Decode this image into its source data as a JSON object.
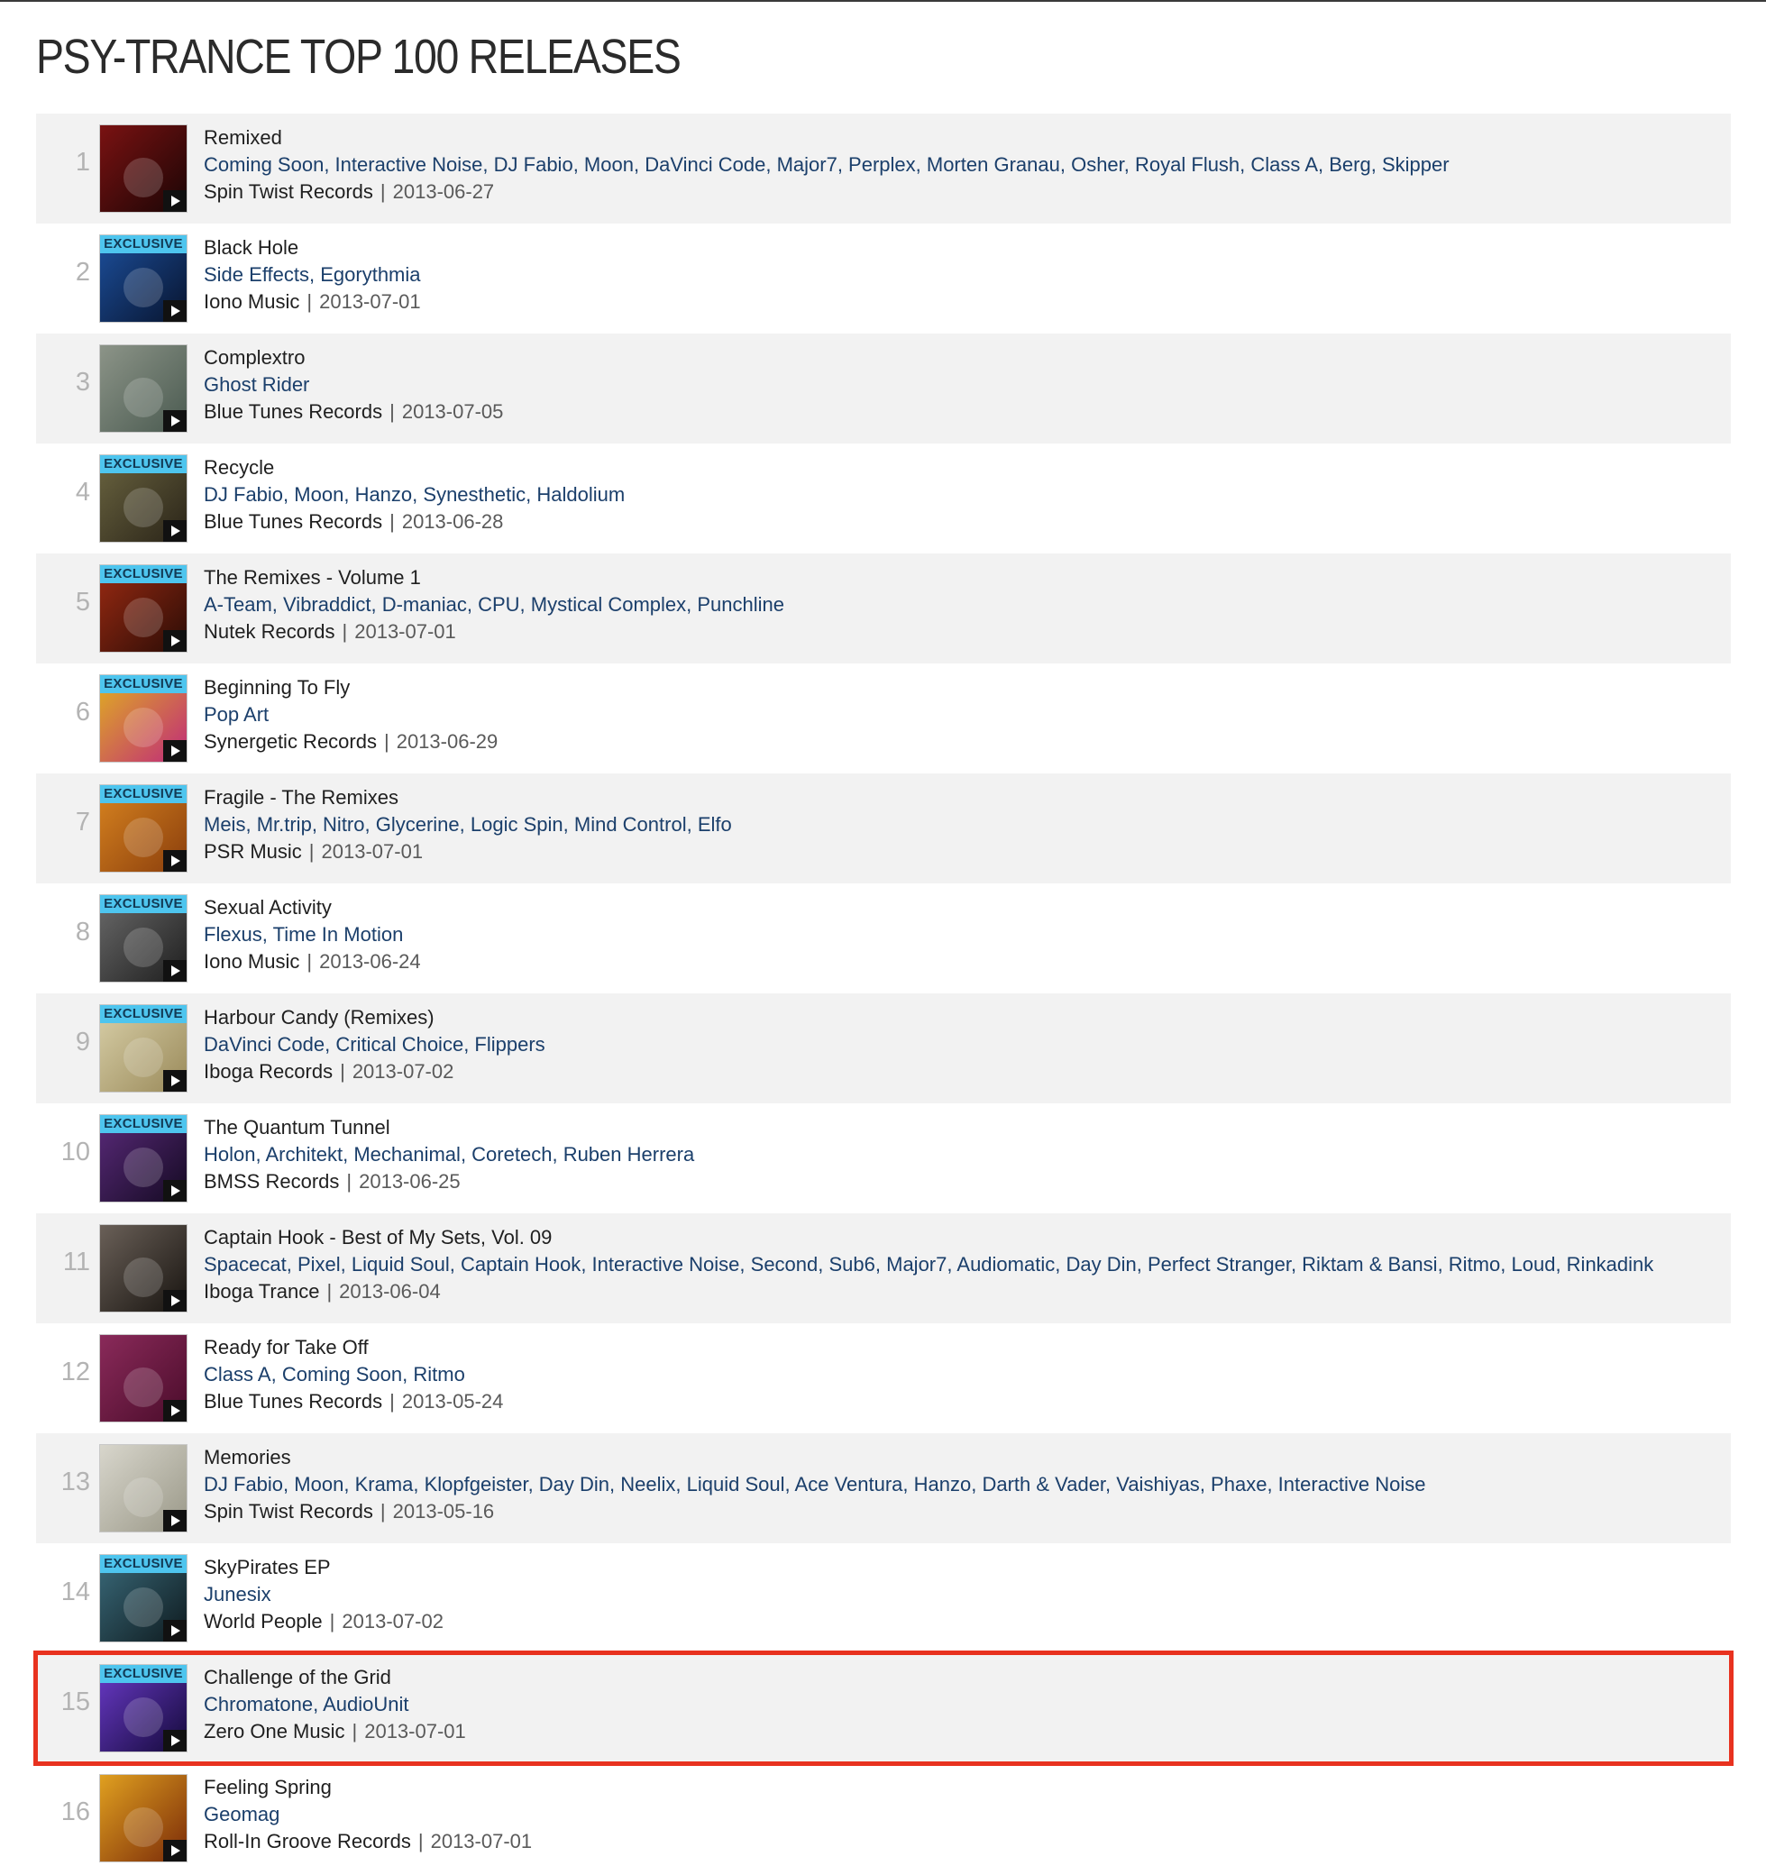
{
  "page": {
    "title": "PSY-TRANCE TOP 100 RELEASES"
  },
  "exclusive_label": "EXCLUSIVE",
  "releases": [
    {
      "rank": "1",
      "title": "Remixed",
      "artists": [
        "Coming Soon",
        "Interactive Noise",
        "DJ Fabio",
        "Moon",
        "DaVinci Code",
        "Major7",
        "Perplex",
        "Morten Granau",
        "Osher",
        "Royal Flush",
        "Class A",
        "Berg",
        "Skipper"
      ],
      "label": "Spin Twist Records",
      "date": "2013-06-27",
      "exclusive": false,
      "cover_color": "#7a1212",
      "cover_color2": "#1a0505"
    },
    {
      "rank": "2",
      "title": "Black Hole",
      "artists": [
        "Side Effects",
        "Egorythmia"
      ],
      "label": "Iono Music",
      "date": "2013-07-01",
      "exclusive": true,
      "cover_color": "#1c4f9c",
      "cover_color2": "#08142e"
    },
    {
      "rank": "3",
      "title": "Complextro",
      "artists": [
        "Ghost Rider"
      ],
      "label": "Blue Tunes Records",
      "date": "2013-07-05",
      "exclusive": false,
      "cover_color": "#8c9488",
      "cover_color2": "#4a5a50"
    },
    {
      "rank": "4",
      "title": "Recycle",
      "artists": [
        "DJ Fabio",
        "Moon",
        "Hanzo",
        "Synesthetic",
        "Haldolium"
      ],
      "label": "Blue Tunes Records",
      "date": "2013-06-28",
      "exclusive": true,
      "cover_color": "#6a6440",
      "cover_color2": "#2a2418"
    },
    {
      "rank": "5",
      "title": "The Remixes - Volume 1",
      "artists": [
        "A-Team",
        "Vibraddict",
        "D-maniac",
        "CPU",
        "Mystical Complex",
        "Punchline"
      ],
      "label": "Nutek Records",
      "date": "2013-07-01",
      "exclusive": true,
      "cover_color": "#9a2a12",
      "cover_color2": "#2a0c06"
    },
    {
      "rank": "6",
      "title": "Beginning To Fly",
      "artists": [
        "Pop Art"
      ],
      "label": "Synergetic Records",
      "date": "2013-06-29",
      "exclusive": true,
      "cover_color": "#e0b020",
      "cover_color2": "#c02a7a"
    },
    {
      "rank": "7",
      "title": "Fragile - The Remixes",
      "artists": [
        "Meis",
        "Mr.trip",
        "Nitro",
        "Glycerine",
        "Logic Spin",
        "Mind Control",
        "Elfo"
      ],
      "label": "PSR Music",
      "date": "2013-07-01",
      "exclusive": true,
      "cover_color": "#d88420",
      "cover_color2": "#8a3e0c"
    },
    {
      "rank": "8",
      "title": "Sexual Activity",
      "artists": [
        "Flexus",
        "Time In Motion"
      ],
      "label": "Iono Music",
      "date": "2013-06-24",
      "exclusive": true,
      "cover_color": "#6a6a6a",
      "cover_color2": "#1e1e1e"
    },
    {
      "rank": "9",
      "title": "Harbour Candy (Remixes)",
      "artists": [
        "DaVinci Code",
        "Critical Choice",
        "Flippers"
      ],
      "label": "Iboga Records",
      "date": "2013-07-02",
      "exclusive": true,
      "cover_color": "#d8cfa8",
      "cover_color2": "#9a8a5a"
    },
    {
      "rank": "10",
      "title": "The Quantum Tunnel",
      "artists": [
        "Holon",
        "Architekt",
        "Mechanimal",
        "Coretech",
        "Ruben Herrera"
      ],
      "label": "BMSS Records",
      "date": "2013-06-25",
      "exclusive": true,
      "cover_color": "#5a2a7a",
      "cover_color2": "#140a22"
    },
    {
      "rank": "11",
      "title": "Captain Hook - Best of My Sets, Vol. 09",
      "artists": [
        "Spacecat",
        "Pixel",
        "Liquid Soul",
        "Captain Hook",
        "Interactive Noise",
        "Second",
        "Sub6",
        "Major7",
        "Audiomatic",
        "Day Din",
        "Perfect Stranger",
        "Riktam & Bansi",
        "Ritmo",
        "Loud",
        "Rinkadink"
      ],
      "label": "Iboga Trance",
      "date": "2013-06-04",
      "exclusive": false,
      "cover_color": "#6a6058",
      "cover_color2": "#181410"
    },
    {
      "rank": "12",
      "title": "Ready for Take Off",
      "artists": [
        "Class A",
        "Coming Soon",
        "Ritmo"
      ],
      "label": "Blue Tunes Records",
      "date": "2013-05-24",
      "exclusive": false,
      "cover_color": "#8a2a5a",
      "cover_color2": "#4a0c2a"
    },
    {
      "rank": "13",
      "title": "Memories",
      "artists": [
        "DJ Fabio",
        "Moon",
        "Krama",
        "Klopfgeister",
        "Day Din",
        "Neelix",
        "Liquid Soul",
        "Ace Ventura",
        "Hanzo",
        "Darth & Vader",
        "Vaishiyas",
        "Phaxe",
        "Interactive Noise"
      ],
      "label": "Spin Twist Records",
      "date": "2013-05-16",
      "exclusive": false,
      "cover_color": "#d8d6cc",
      "cover_color2": "#9a9888"
    },
    {
      "rank": "14",
      "title": "SkyPirates EP",
      "artists": [
        "Junesix"
      ],
      "label": "World People",
      "date": "2013-07-02",
      "exclusive": true,
      "cover_color": "#3a6a7a",
      "cover_color2": "#0e1a1e"
    },
    {
      "rank": "15",
      "title": "Challenge of the Grid",
      "artists": [
        "Chromatone",
        "AudioUnit"
      ],
      "label": "Zero One Music",
      "date": "2013-07-01",
      "exclusive": true,
      "cover_color": "#6a3ac8",
      "cover_color2": "#140a3a",
      "highlighted": true
    },
    {
      "rank": "16",
      "title": "Feeling Spring",
      "artists": [
        "Geomag"
      ],
      "label": "Roll-In Groove Records",
      "date": "2013-07-01",
      "exclusive": false,
      "cover_color": "#e0a020",
      "cover_color2": "#7a2a08"
    }
  ]
}
